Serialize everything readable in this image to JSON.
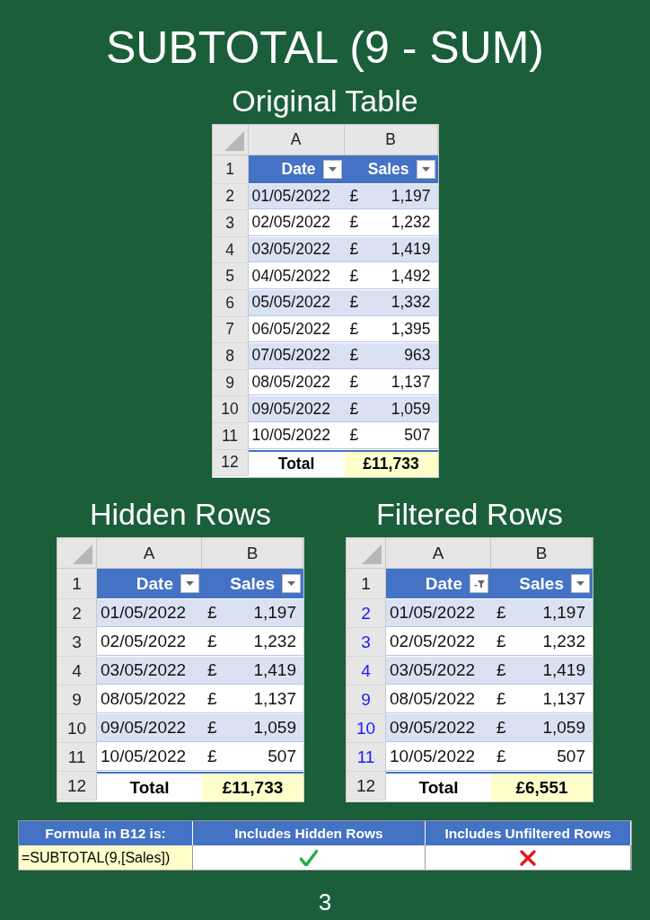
{
  "title": "SUBTOTAL (9 - SUM)",
  "tables": [
    {
      "title": "Original Table",
      "columns": [
        "A",
        "B"
      ],
      "header_row": "1",
      "headers": [
        {
          "label": "Date",
          "filtered": false
        },
        {
          "label": "Sales",
          "filtered": false
        }
      ],
      "row_numbers_filtered": false,
      "rows": [
        {
          "num": "2",
          "date": "01/05/2022",
          "currency": "£",
          "amount": "1,197"
        },
        {
          "num": "3",
          "date": "02/05/2022",
          "currency": "£",
          "amount": "1,232"
        },
        {
          "num": "4",
          "date": "03/05/2022",
          "currency": "£",
          "amount": "1,419"
        },
        {
          "num": "5",
          "date": "04/05/2022",
          "currency": "£",
          "amount": "1,492"
        },
        {
          "num": "6",
          "date": "05/05/2022",
          "currency": "£",
          "amount": "1,332"
        },
        {
          "num": "7",
          "date": "06/05/2022",
          "currency": "£",
          "amount": "1,395"
        },
        {
          "num": "8",
          "date": "07/05/2022",
          "currency": "£",
          "amount": "963"
        },
        {
          "num": "9",
          "date": "08/05/2022",
          "currency": "£",
          "amount": "1,137"
        },
        {
          "num": "10",
          "date": "09/05/2022",
          "currency": "£",
          "amount": "1,059"
        },
        {
          "num": "11",
          "date": "10/05/2022",
          "currency": "£",
          "amount": "507"
        }
      ],
      "total": {
        "num": "12",
        "label": "Total",
        "value": "£11,733"
      }
    },
    {
      "title": "Hidden Rows",
      "columns": [
        "A",
        "B"
      ],
      "header_row": "1",
      "headers": [
        {
          "label": "Date",
          "filtered": false
        },
        {
          "label": "Sales",
          "filtered": false
        }
      ],
      "row_numbers_filtered": false,
      "rows": [
        {
          "num": "2",
          "date": "01/05/2022",
          "currency": "£",
          "amount": "1,197"
        },
        {
          "num": "3",
          "date": "02/05/2022",
          "currency": "£",
          "amount": "1,232"
        },
        {
          "num": "4",
          "date": "03/05/2022",
          "currency": "£",
          "amount": "1,419"
        },
        {
          "num": "9",
          "date": "08/05/2022",
          "currency": "£",
          "amount": "1,137"
        },
        {
          "num": "10",
          "date": "09/05/2022",
          "currency": "£",
          "amount": "1,059"
        },
        {
          "num": "11",
          "date": "10/05/2022",
          "currency": "£",
          "amount": "507"
        }
      ],
      "total": {
        "num": "12",
        "label": "Total",
        "value": "£11,733"
      }
    },
    {
      "title": "Filtered Rows",
      "columns": [
        "A",
        "B"
      ],
      "header_row": "1",
      "headers": [
        {
          "label": "Date",
          "filtered": true
        },
        {
          "label": "Sales",
          "filtered": false
        }
      ],
      "row_numbers_filtered": true,
      "rows": [
        {
          "num": "2",
          "date": "01/05/2022",
          "currency": "£",
          "amount": "1,197"
        },
        {
          "num": "3",
          "date": "02/05/2022",
          "currency": "£",
          "amount": "1,232"
        },
        {
          "num": "4",
          "date": "03/05/2022",
          "currency": "£",
          "amount": "1,419"
        },
        {
          "num": "9",
          "date": "08/05/2022",
          "currency": "£",
          "amount": "1,137"
        },
        {
          "num": "10",
          "date": "09/05/2022",
          "currency": "£",
          "amount": "1,059"
        },
        {
          "num": "11",
          "date": "10/05/2022",
          "currency": "£",
          "amount": "507"
        }
      ],
      "total": {
        "num": "12",
        "label": "Total",
        "value": "£6,551"
      }
    }
  ],
  "summary": {
    "headers": [
      "Formula in B12 is:",
      "Includes Hidden Rows",
      "Includes Unfiltered Rows"
    ],
    "formula": "=SUBTOTAL(9,[Sales])",
    "results": [
      {
        "included": true
      },
      {
        "included": false
      }
    ]
  },
  "page_number": "3"
}
